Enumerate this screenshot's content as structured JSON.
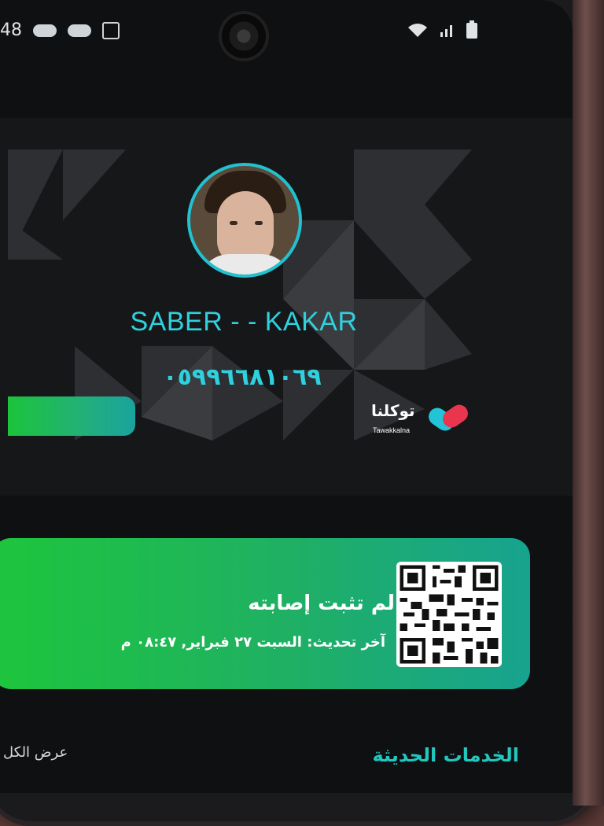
{
  "status_bar": {
    "time_fragment": "48",
    "icons": [
      "cloud-icon",
      "cloud-icon",
      "checkbox-icon",
      "wifi-icon",
      "signal-icon",
      "battery-icon"
    ]
  },
  "profile": {
    "name": "SABER - - KAKAR",
    "id_number": "٠٥٩٩٦٦٨١٠٦٩"
  },
  "logo": {
    "arabic": "توكلنا",
    "latin": "Tawakkalna"
  },
  "health_status": {
    "title": "لم تثبت إصابته",
    "last_update": "آخر تحديث: السبت ٢٧ فبراير, ٠٨:٤٧ م"
  },
  "sections": {
    "services_title": "الخدمات الحديثة",
    "view_all": "عرض الكل"
  },
  "colors": {
    "accent_cyan": "#2fd1de",
    "status_green": "#1ec53c",
    "status_teal": "#17a38f"
  }
}
